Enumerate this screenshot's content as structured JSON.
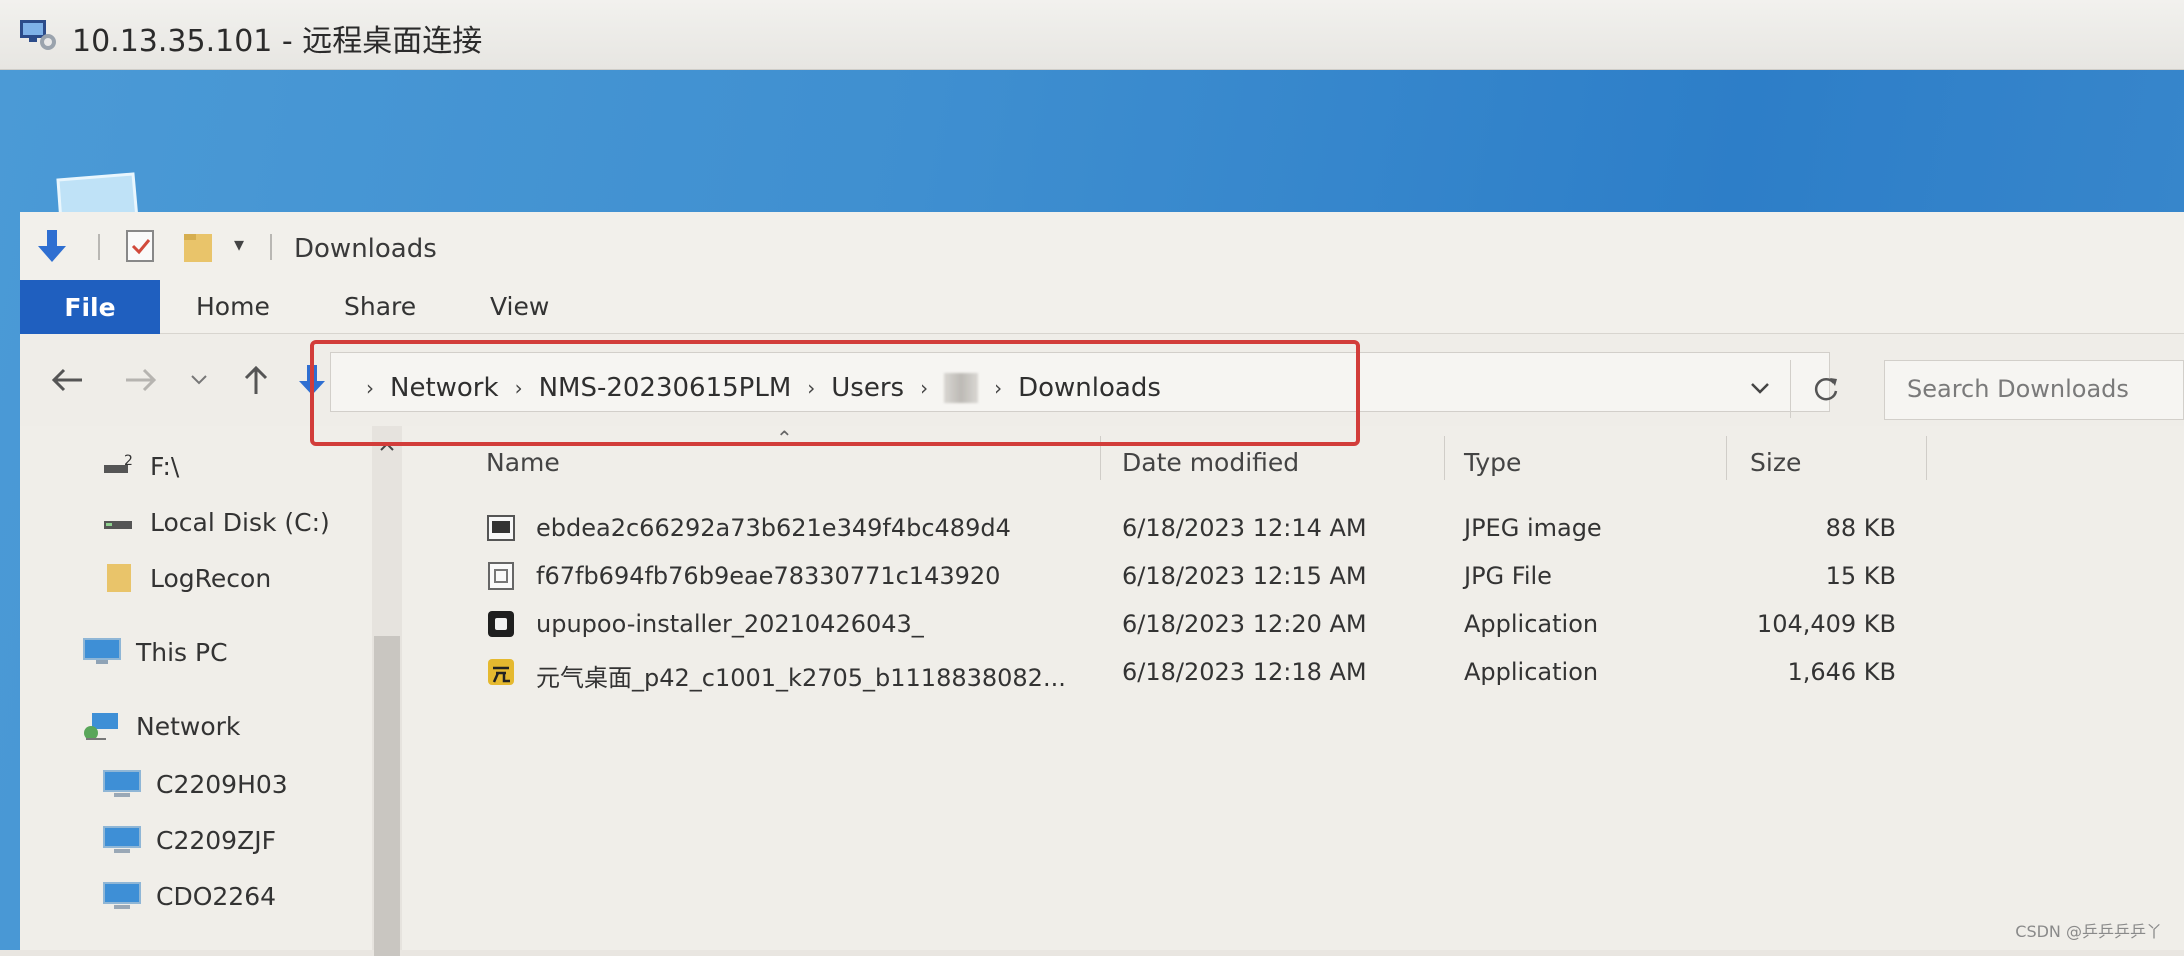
{
  "rdp": {
    "title": "10.13.35.101 - 远程桌面连接"
  },
  "explorer": {
    "window_title": "Downloads",
    "ribbon_tabs": {
      "file": "File",
      "home": "Home",
      "share": "Share",
      "view": "View"
    },
    "address": {
      "crumbs": [
        "Network",
        "NMS-20230615PLM",
        "Users",
        "Downloads"
      ]
    },
    "search": {
      "placeholder": "Search Downloads"
    },
    "nav_pane": {
      "items": [
        {
          "label": "F:\\",
          "icon": "drive-icon"
        },
        {
          "label": "Local Disk (C:)",
          "icon": "drive-icon"
        },
        {
          "label": "LogRecon",
          "icon": "folder-icon"
        },
        {
          "label": "This PC",
          "icon": "pc-icon"
        },
        {
          "label": "Network",
          "icon": "network-icon"
        },
        {
          "label": "C2209H03",
          "icon": "computer-icon"
        },
        {
          "label": "C2209ZJF",
          "icon": "computer-icon"
        },
        {
          "label": "CDO2264",
          "icon": "computer-icon"
        }
      ]
    },
    "columns": {
      "name": "Name",
      "date": "Date modified",
      "type": "Type",
      "size": "Size"
    },
    "files": [
      {
        "name": "ebdea2c66292a73b621e349f4bc489d4",
        "date": "6/18/2023 12:14 AM",
        "type": "JPEG image",
        "size": "88 KB",
        "icon": "image-file-icon"
      },
      {
        "name": "f67fb694fb76b9eae78330771c143920",
        "date": "6/18/2023 12:15 AM",
        "type": "JPG File",
        "size": "15 KB",
        "icon": "generic-file-icon"
      },
      {
        "name": "upupoo-installer_20210426043_",
        "date": "6/18/2023 12:20 AM",
        "type": "Application",
        "size": "104,409 KB",
        "icon": "app-icon"
      },
      {
        "name": "元气桌面_p42_c1001_k2705_b1118838082...",
        "date": "6/18/2023 12:18 AM",
        "type": "Application",
        "size": "1,646 KB",
        "icon": "yuanqi-app-icon"
      }
    ]
  },
  "watermark": "CSDN @乒乒乒乒丫",
  "colors": {
    "file_tab": "#1f5fbf",
    "highlight": "#d23d3a",
    "desktop": "#3f8fd0"
  }
}
